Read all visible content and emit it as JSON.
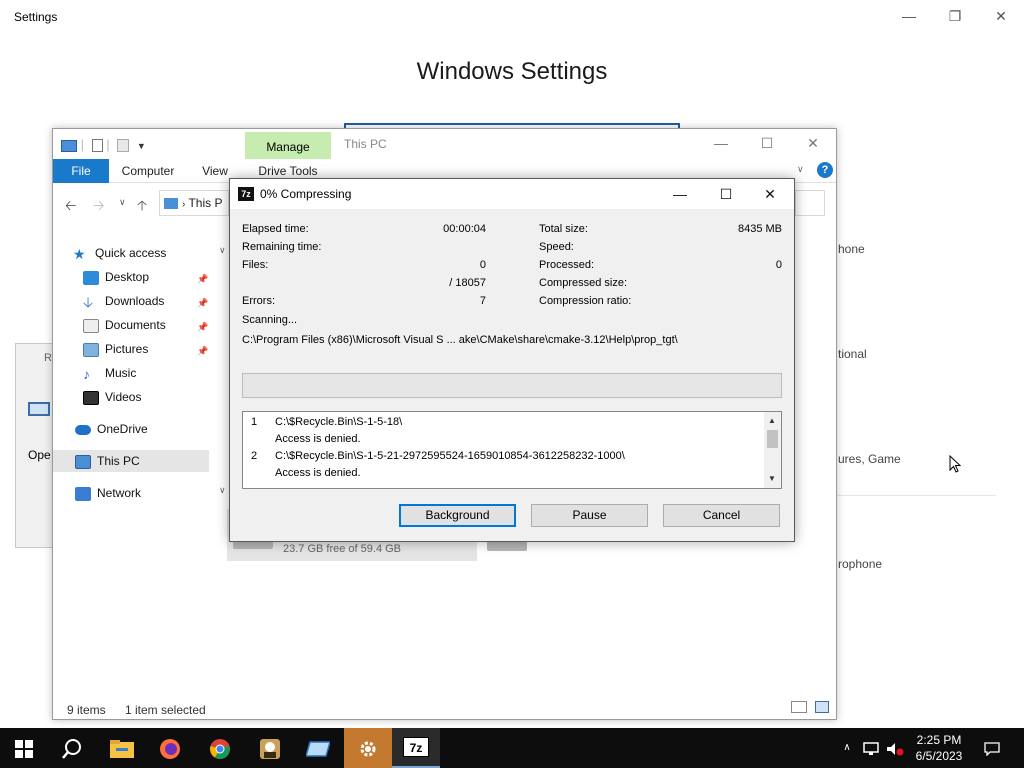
{
  "settings": {
    "window_title": "Settings",
    "heading": "Windows Settings",
    "fragments": [
      "hone",
      "tional",
      "ures, Game",
      "rophone"
    ]
  },
  "small_window": {
    "title": "R",
    "text": "Ope"
  },
  "explorer": {
    "title": "This PC",
    "manage_tab": "Manage",
    "tabs": [
      "File",
      "Computer",
      "View",
      "Drive Tools"
    ],
    "address": "This P",
    "nav": {
      "quick_access": "Quick access",
      "desktop": "Desktop",
      "downloads": "Downloads",
      "documents": "Documents",
      "pictures": "Pictures",
      "music": "Music",
      "videos": "Videos",
      "onedrive": "OneDrive",
      "this_pc": "This PC",
      "network": "Network"
    },
    "drive_free": "23.7 GB free of 59.4 GB",
    "status_items": "9 items",
    "status_selected": "1 item selected"
  },
  "zip_dialog": {
    "title": "0% Compressing",
    "elapsed_label": "Elapsed time:",
    "elapsed_value": "00:00:04",
    "remaining_label": "Remaining time:",
    "files_label": "Files:",
    "files_value": "0",
    "files_total": "/ 18057",
    "errors_label": "Errors:",
    "errors_value": "7",
    "total_size_label": "Total size:",
    "total_size_value": "8435 MB",
    "speed_label": "Speed:",
    "processed_label": "Processed:",
    "processed_value": "0",
    "compressed_size_label": "Compressed size:",
    "compression_ratio_label": "Compression ratio:",
    "scanning": "Scanning...",
    "current_path": "C:\\Program Files (x86)\\Microsoft Visual S ... ake\\CMake\\share\\cmake-3.12\\Help\\prop_tgt\\",
    "progress": 0,
    "log": [
      {
        "num": "1",
        "path": "C:\\$Recycle.Bin\\S-1-5-18\\",
        "msg": "Access is denied."
      },
      {
        "num": "2",
        "path": "C:\\$Recycle.Bin\\S-1-5-21-2972595524-1659010854-3612258232-1000\\",
        "msg": "Access is denied."
      }
    ],
    "buttons": {
      "background": "Background",
      "pause": "Pause",
      "cancel": "Cancel"
    }
  },
  "taskbar": {
    "time": "2:25 PM",
    "date": "6/5/2023",
    "icons": [
      "windows-start-icon",
      "search-icon",
      "file-explorer-icon",
      "firefox-icon",
      "chrome-icon",
      "app-icon",
      "network-drive-icon",
      "settings-icon",
      "7zip-icon"
    ]
  },
  "colors": {
    "accent": "#1979ca",
    "manage_green": "#c6ecb0",
    "taskbar": "#0d0d0d",
    "settings_highlight": "#c37a30"
  }
}
